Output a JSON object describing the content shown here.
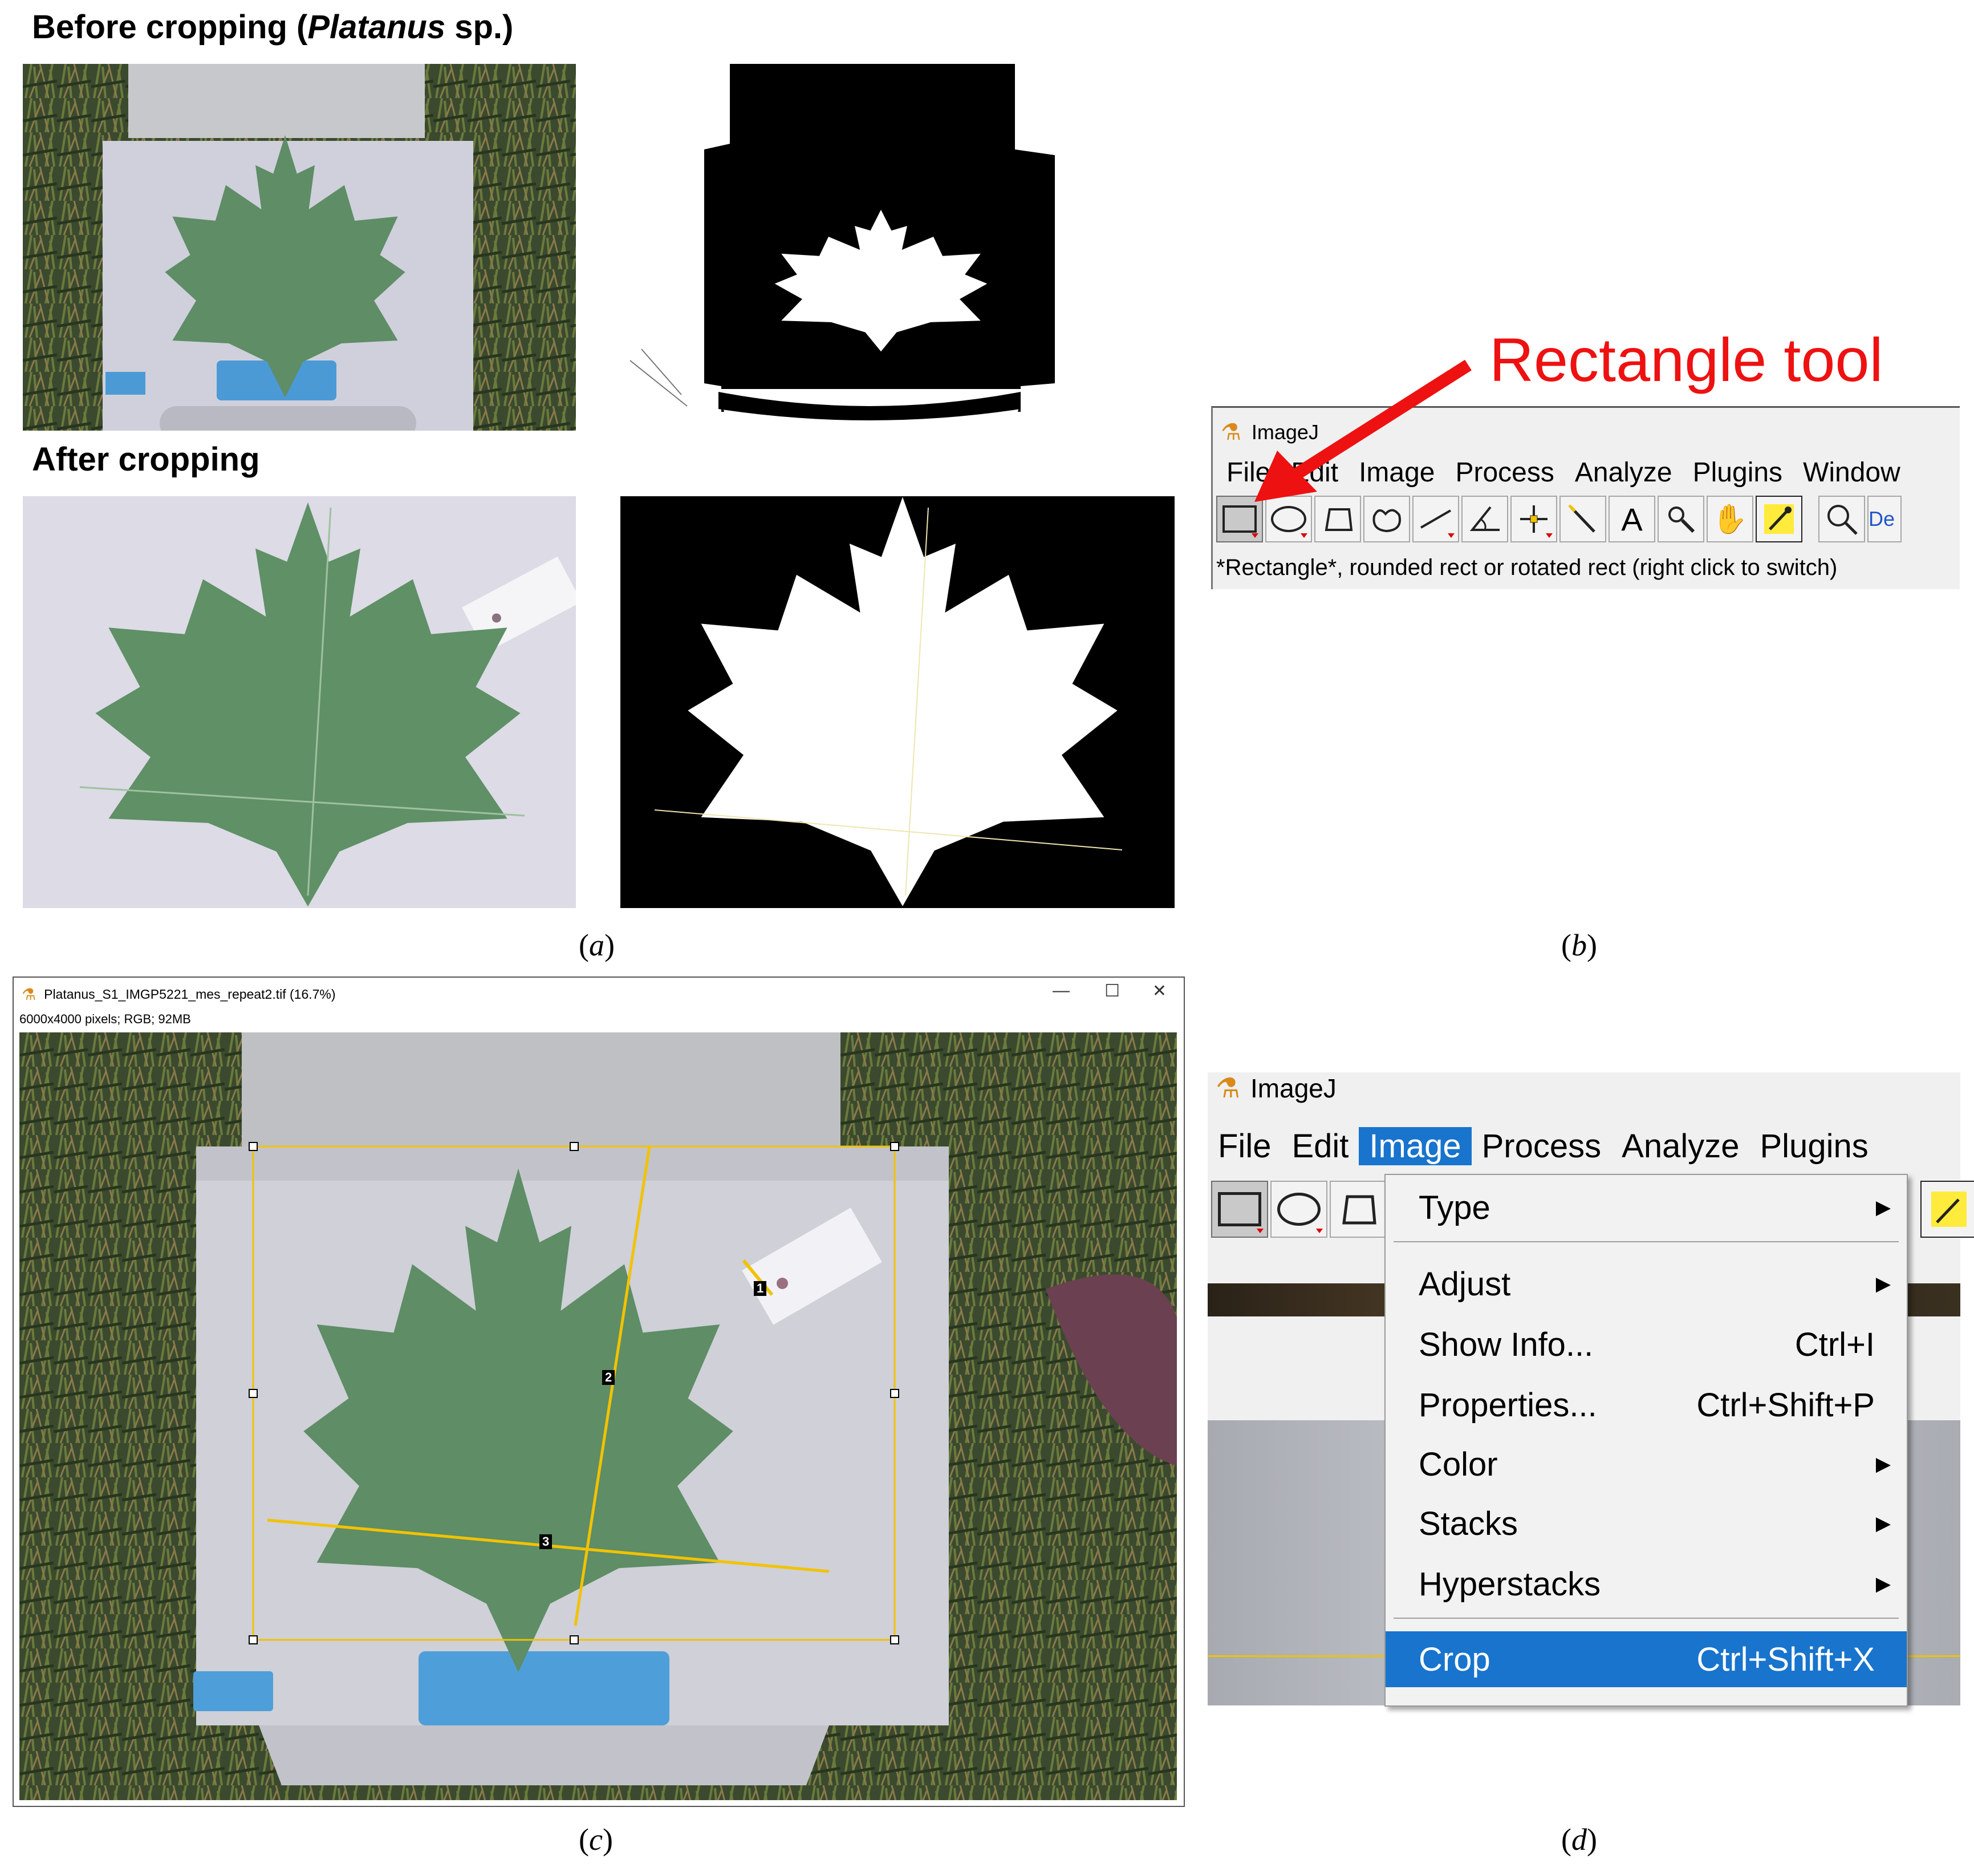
{
  "panel_a": {
    "before_title_prefix": "Before cropping (",
    "before_title_italic": "Platanus",
    "before_title_suffix": " sp.)",
    "after_title": "After cropping",
    "caption_open": "(",
    "caption_letter": "a",
    "caption_close": ")"
  },
  "panel_b": {
    "annotation": "Rectangle tool",
    "annotation_color": "#ee1111",
    "app_title": "ImageJ",
    "menu": [
      "File",
      "Edit",
      "Image",
      "Process",
      "Analyze",
      "Plugins",
      "Window"
    ],
    "tools": [
      "rectangle-icon",
      "oval-icon",
      "polygon-icon",
      "freehand-icon",
      "line-icon",
      "angle-icon",
      "point-icon",
      "wand-icon",
      "text-icon",
      "magnifier-icon",
      "hand-icon",
      "dropper-icon",
      "search-icon"
    ],
    "text_tool_glyph": "A",
    "dev_label": "De",
    "status": "*Rectangle*, rounded rect or rotated rect (right click to switch)",
    "caption_letter": "b"
  },
  "panel_c": {
    "window_title": "Platanus_S1_IMGP5221_mes_repeat2.tif (16.7%)",
    "image_info": "6000x4000 pixels; RGB; 92MB",
    "minimize": "—",
    "maximize": "☐",
    "close": "✕",
    "measure_labels": [
      "1",
      "2",
      "3"
    ],
    "selection_color": "#f2c200",
    "caption_letter": "c"
  },
  "panel_d": {
    "app_title": "ImageJ",
    "menu": [
      "File",
      "Edit",
      "Image",
      "Process",
      "Analyze",
      "Plugins"
    ],
    "active_menu": "Image",
    "items": [
      {
        "label": "Type",
        "shortcut": "",
        "submenu": true
      },
      {
        "label": "Adjust",
        "shortcut": "",
        "submenu": true
      },
      {
        "label": "Show Info...",
        "shortcut": "Ctrl+I",
        "submenu": false
      },
      {
        "label": "Properties...",
        "shortcut": "Ctrl+Shift+P",
        "submenu": false
      },
      {
        "label": "Color",
        "shortcut": "",
        "submenu": true
      },
      {
        "label": "Stacks",
        "shortcut": "",
        "submenu": true
      },
      {
        "label": "Hyperstacks",
        "shortcut": "",
        "submenu": true
      },
      {
        "label": "Crop",
        "shortcut": "Ctrl+Shift+X",
        "submenu": false
      }
    ],
    "highlight_color": "#1874cd",
    "caption_letter": "d"
  }
}
